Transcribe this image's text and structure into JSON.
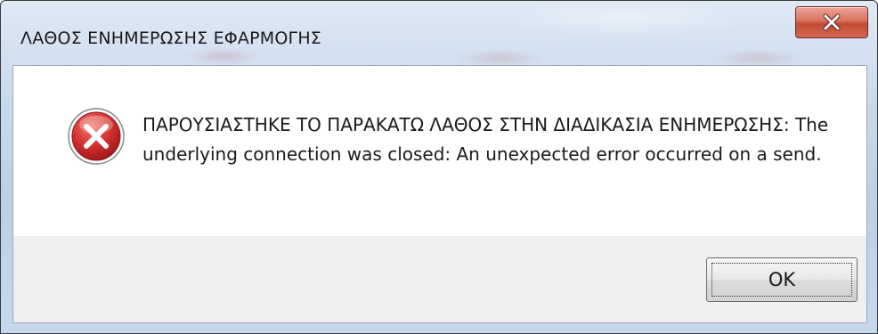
{
  "window": {
    "title": "ΛΑΘΟΣ ΕΝΗΜΕΡΩΣΗΣ ΕΦΑΡΜΟΓΗΣ",
    "close_icon": "close-icon"
  },
  "dialog": {
    "icon": "error-icon",
    "message": "ΠΑΡΟΥΣΙΑΣΤΗΚΕ ΤΟ ΠΑΡΑΚΑΤΩ ΛΑΘΟΣ ΣΤΗΝ ΔΙΑΔΙΚΑΣΙΑ ΕΝΗΜΕΡΩΣΗΣ: The underlying connection was closed: An unexpected error occurred on a send.",
    "ok_label": "OK"
  },
  "colors": {
    "close_button": "#c24a33",
    "error_icon": "#c8262a",
    "frame": "#bcd0e8"
  }
}
